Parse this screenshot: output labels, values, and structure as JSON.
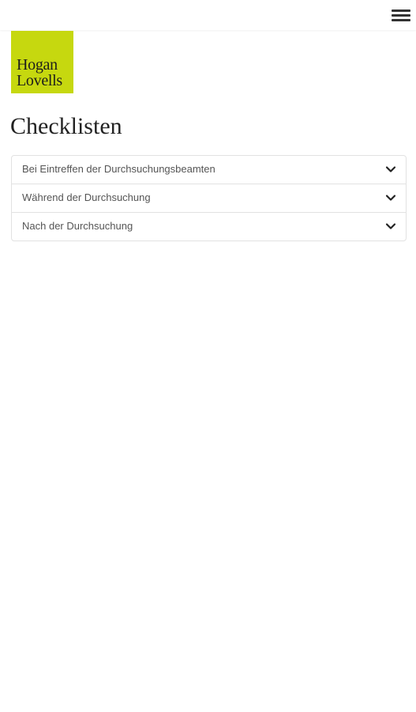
{
  "header": {
    "menu_icon": "hamburger-menu-icon"
  },
  "logo": {
    "line1": "Hogan",
    "line2": "Lovells",
    "color": "#c6d80f"
  },
  "page": {
    "title": "Checklisten"
  },
  "accordion": {
    "items": [
      {
        "label": "Bei Eintreffen der Durchsuchungsbeamten",
        "icon": "chevron-down-icon"
      },
      {
        "label": "Während der Durchsuchung",
        "icon": "chevron-down-icon"
      },
      {
        "label": "Nach der Durchsuchung",
        "icon": "chevron-down-icon"
      }
    ]
  }
}
